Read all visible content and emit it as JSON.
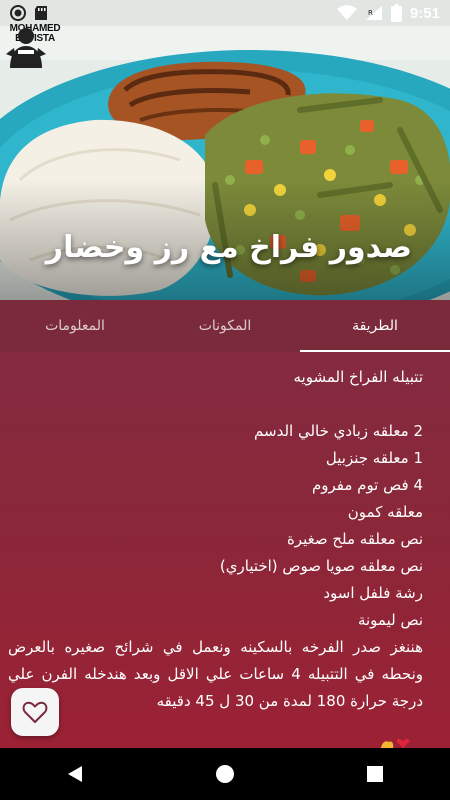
{
  "status_bar": {
    "time": "9:51",
    "icons": [
      "circle-notification-icon",
      "sd-card-icon",
      "wifi-icon",
      "cellular-signal-icon",
      "battery-icon"
    ]
  },
  "hero": {
    "title": "صدور فراخ مع رز وخضار",
    "logo_line1": "MOHAMED",
    "logo_line2": "BATISTA"
  },
  "tabs": [
    {
      "label": "الطريقة",
      "active": true
    },
    {
      "label": "المكونات",
      "active": false
    },
    {
      "label": "المعلومات",
      "active": false
    }
  ],
  "recipe": {
    "heading": "تتبيله الفراخ المشويه",
    "lines": [
      "2 معلقه زبادي خالي الدسم",
      "1 معلقه جنزبيل",
      "4 فص توم مفروم",
      "معلقه كمون",
      "نص معلقه ملح صغيرة",
      "نص معلقه صويا صوص (اختياري)",
      "رشة فلفل اسود",
      "نص ليمونة"
    ],
    "paragraph": "هننغز صدر الفرخه بالسكينه ونعمل في شرائح صغيره بالعرض ونحطه في التتبيله 4 ساعات علي الاقل وبعد هندخله الفرن علي درجة حرارة 180 لمدة من 30 ل 45 دقيقه"
  },
  "colors": {
    "tab_bar": "#7a2a3b",
    "content_top": "#842a40",
    "content_bottom": "#9c2135"
  },
  "nav": {
    "buttons": [
      "back-icon",
      "home-icon",
      "recents-icon"
    ]
  }
}
